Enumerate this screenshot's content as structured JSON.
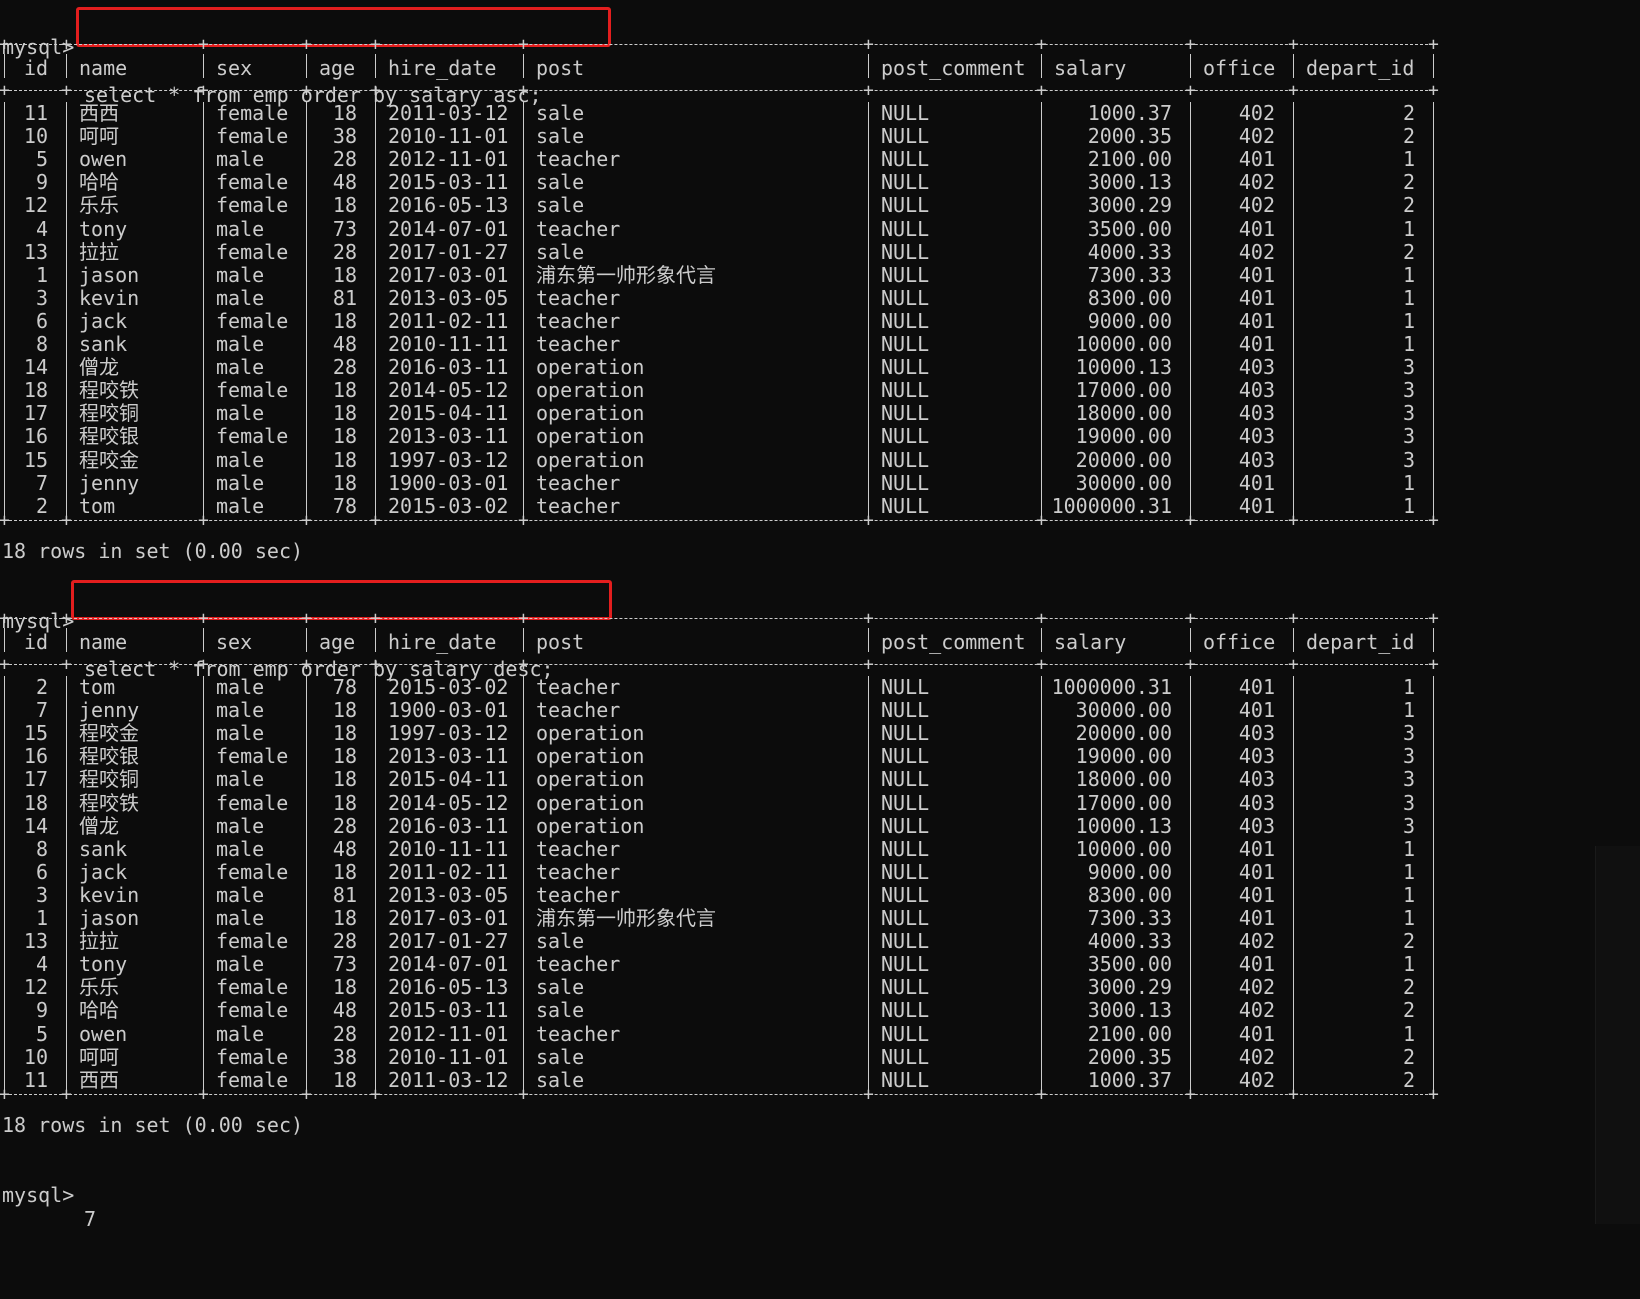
{
  "prompt": "mysql>",
  "queries": [
    {
      "command": "select * from emp order by salary asc;",
      "footer": "18 rows in set (0.00 sec)"
    },
    {
      "command": "select * from emp order by salary desc;",
      "footer": "18 rows in set (0.00 sec)"
    }
  ],
  "columns": [
    "id",
    "name",
    "sex",
    "age",
    "hire_date",
    "post",
    "post_comment",
    "salary",
    "office",
    "depart_id"
  ],
  "tables": [
    [
      [
        "11",
        "西西",
        "female",
        "18",
        "2011-03-12",
        "sale",
        "NULL",
        "1000.37",
        "402",
        "2"
      ],
      [
        "10",
        "呵呵",
        "female",
        "38",
        "2010-11-01",
        "sale",
        "NULL",
        "2000.35",
        "402",
        "2"
      ],
      [
        "5",
        "owen",
        "male",
        "28",
        "2012-11-01",
        "teacher",
        "NULL",
        "2100.00",
        "401",
        "1"
      ],
      [
        "9",
        "哈哈",
        "female",
        "48",
        "2015-03-11",
        "sale",
        "NULL",
        "3000.13",
        "402",
        "2"
      ],
      [
        "12",
        "乐乐",
        "female",
        "18",
        "2016-05-13",
        "sale",
        "NULL",
        "3000.29",
        "402",
        "2"
      ],
      [
        "4",
        "tony",
        "male",
        "73",
        "2014-07-01",
        "teacher",
        "NULL",
        "3500.00",
        "401",
        "1"
      ],
      [
        "13",
        "拉拉",
        "female",
        "28",
        "2017-01-27",
        "sale",
        "NULL",
        "4000.33",
        "402",
        "2"
      ],
      [
        "1",
        "jason",
        "male",
        "18",
        "2017-03-01",
        "浦东第一帅形象代言",
        "NULL",
        "7300.33",
        "401",
        "1"
      ],
      [
        "3",
        "kevin",
        "male",
        "81",
        "2013-03-05",
        "teacher",
        "NULL",
        "8300.00",
        "401",
        "1"
      ],
      [
        "6",
        "jack",
        "female",
        "18",
        "2011-02-11",
        "teacher",
        "NULL",
        "9000.00",
        "401",
        "1"
      ],
      [
        "8",
        "sank",
        "male",
        "48",
        "2010-11-11",
        "teacher",
        "NULL",
        "10000.00",
        "401",
        "1"
      ],
      [
        "14",
        "僧龙",
        "male",
        "28",
        "2016-03-11",
        "operation",
        "NULL",
        "10000.13",
        "403",
        "3"
      ],
      [
        "18",
        "程咬铁",
        "female",
        "18",
        "2014-05-12",
        "operation",
        "NULL",
        "17000.00",
        "403",
        "3"
      ],
      [
        "17",
        "程咬铜",
        "male",
        "18",
        "2015-04-11",
        "operation",
        "NULL",
        "18000.00",
        "403",
        "3"
      ],
      [
        "16",
        "程咬银",
        "female",
        "18",
        "2013-03-11",
        "operation",
        "NULL",
        "19000.00",
        "403",
        "3"
      ],
      [
        "15",
        "程咬金",
        "male",
        "18",
        "1997-03-12",
        "operation",
        "NULL",
        "20000.00",
        "403",
        "3"
      ],
      [
        "7",
        "jenny",
        "male",
        "18",
        "1900-03-01",
        "teacher",
        "NULL",
        "30000.00",
        "401",
        "1"
      ],
      [
        "2",
        "tom",
        "male",
        "78",
        "2015-03-02",
        "teacher",
        "NULL",
        "1000000.31",
        "401",
        "1"
      ]
    ],
    [
      [
        "2",
        "tom",
        "male",
        "78",
        "2015-03-02",
        "teacher",
        "NULL",
        "1000000.31",
        "401",
        "1"
      ],
      [
        "7",
        "jenny",
        "male",
        "18",
        "1900-03-01",
        "teacher",
        "NULL",
        "30000.00",
        "401",
        "1"
      ],
      [
        "15",
        "程咬金",
        "male",
        "18",
        "1997-03-12",
        "operation",
        "NULL",
        "20000.00",
        "403",
        "3"
      ],
      [
        "16",
        "程咬银",
        "female",
        "18",
        "2013-03-11",
        "operation",
        "NULL",
        "19000.00",
        "403",
        "3"
      ],
      [
        "17",
        "程咬铜",
        "male",
        "18",
        "2015-04-11",
        "operation",
        "NULL",
        "18000.00",
        "403",
        "3"
      ],
      [
        "18",
        "程咬铁",
        "female",
        "18",
        "2014-05-12",
        "operation",
        "NULL",
        "17000.00",
        "403",
        "3"
      ],
      [
        "14",
        "僧龙",
        "male",
        "28",
        "2016-03-11",
        "operation",
        "NULL",
        "10000.13",
        "403",
        "3"
      ],
      [
        "8",
        "sank",
        "male",
        "48",
        "2010-11-11",
        "teacher",
        "NULL",
        "10000.00",
        "401",
        "1"
      ],
      [
        "6",
        "jack",
        "female",
        "18",
        "2011-02-11",
        "teacher",
        "NULL",
        "9000.00",
        "401",
        "1"
      ],
      [
        "3",
        "kevin",
        "male",
        "81",
        "2013-03-05",
        "teacher",
        "NULL",
        "8300.00",
        "401",
        "1"
      ],
      [
        "1",
        "jason",
        "male",
        "18",
        "2017-03-01",
        "浦东第一帅形象代言",
        "NULL",
        "7300.33",
        "401",
        "1"
      ],
      [
        "13",
        "拉拉",
        "female",
        "28",
        "2017-01-27",
        "sale",
        "NULL",
        "4000.33",
        "402",
        "2"
      ],
      [
        "4",
        "tony",
        "male",
        "73",
        "2014-07-01",
        "teacher",
        "NULL",
        "3500.00",
        "401",
        "1"
      ],
      [
        "12",
        "乐乐",
        "female",
        "18",
        "2016-05-13",
        "sale",
        "NULL",
        "3000.29",
        "402",
        "2"
      ],
      [
        "9",
        "哈哈",
        "female",
        "48",
        "2015-03-11",
        "sale",
        "NULL",
        "3000.13",
        "402",
        "2"
      ],
      [
        "5",
        "owen",
        "male",
        "28",
        "2012-11-01",
        "teacher",
        "NULL",
        "2100.00",
        "401",
        "1"
      ],
      [
        "10",
        "呵呵",
        "female",
        "38",
        "2010-11-01",
        "sale",
        "NULL",
        "2000.35",
        "402",
        "2"
      ],
      [
        "11",
        "西西",
        "female",
        "18",
        "2011-03-12",
        "sale",
        "NULL",
        "1000.37",
        "402",
        "2"
      ]
    ]
  ],
  "final_prompt_input": "7",
  "colors": {
    "background": "#0c0c0c",
    "text": "#cccccc",
    "highlight_box": "#e31e1e"
  }
}
